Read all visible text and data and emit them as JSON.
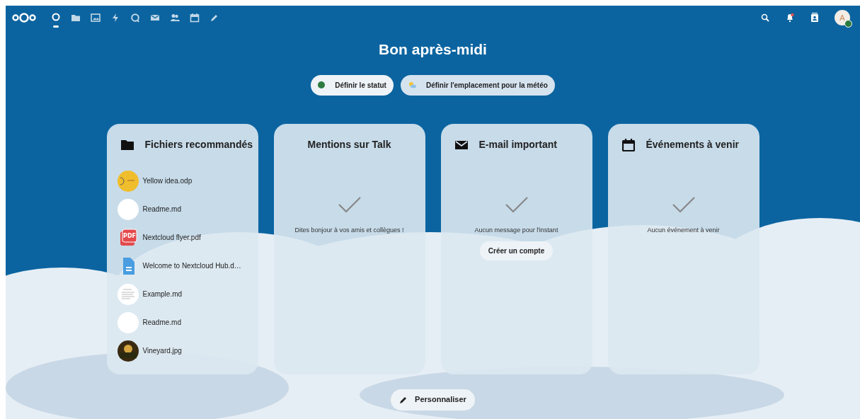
{
  "header": {
    "apps": [
      {
        "kind": "dashboard",
        "selected": true
      },
      {
        "kind": "files",
        "selected": false
      },
      {
        "kind": "photos",
        "selected": false
      },
      {
        "kind": "activity",
        "selected": false
      },
      {
        "kind": "talk",
        "selected": false
      },
      {
        "kind": "mail",
        "selected": false
      },
      {
        "kind": "contacts",
        "selected": false
      },
      {
        "kind": "calendar",
        "selected": false
      },
      {
        "kind": "notes",
        "selected": false
      }
    ],
    "avatar": {
      "initial": "A"
    }
  },
  "greeting": "Bon après-midi",
  "status_buttons": [
    {
      "kind": "status",
      "label": "Définir le statut"
    },
    {
      "kind": "weather",
      "label": "Définir l'emplacement pour la météo"
    }
  ],
  "widgets": [
    {
      "kind": "files",
      "title": "Fichiers recommandés",
      "files": [
        {
          "kind": "image",
          "name": "Yellow idea.odp"
        },
        {
          "kind": "blank",
          "name": "Readme.md"
        },
        {
          "kind": "pdf",
          "badge": "PDF",
          "name": "Nextcloud flyer.pdf"
        },
        {
          "kind": "document",
          "name": "Welcome to Nextcloud Hub.d…"
        },
        {
          "kind": "text",
          "name": "Example.md"
        },
        {
          "kind": "blank",
          "name": "Readme.md"
        },
        {
          "kind": "photo",
          "name": "Vineyard.jpg"
        }
      ]
    },
    {
      "kind": "talk",
      "title": "Mentions sur Talk",
      "empty_text": "Dites bonjour à vos amis et collègues !"
    },
    {
      "kind": "mail",
      "title": "E-mail important",
      "empty_text": "Aucun message pour l'instant",
      "action": "Créer un compte"
    },
    {
      "kind": "calendar",
      "title": "Événements à venir",
      "empty_text": "Aucun événement à venir"
    }
  ],
  "customize_button": "Personnaliser"
}
